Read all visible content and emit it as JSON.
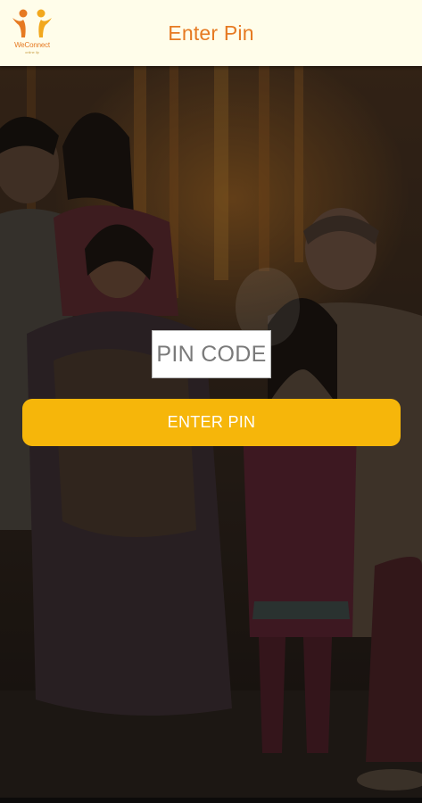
{
  "app_bar": {
    "title": "Enter Pin",
    "logo": {
      "name": "WeConnect",
      "tagline": "online llp",
      "icon": "two-people-logo-icon",
      "colors": [
        "#e67a22",
        "#f2a81d"
      ]
    }
  },
  "hero": {
    "image": "family-group-photo"
  },
  "form": {
    "pin_placeholder": "PIN CODE",
    "submit_label": "ENTER PIN"
  },
  "colors": {
    "app_bar_bg": "#fffdea",
    "title": "#e67a22",
    "button_bg": "#f6b60a",
    "button_text": "#ffffff"
  }
}
